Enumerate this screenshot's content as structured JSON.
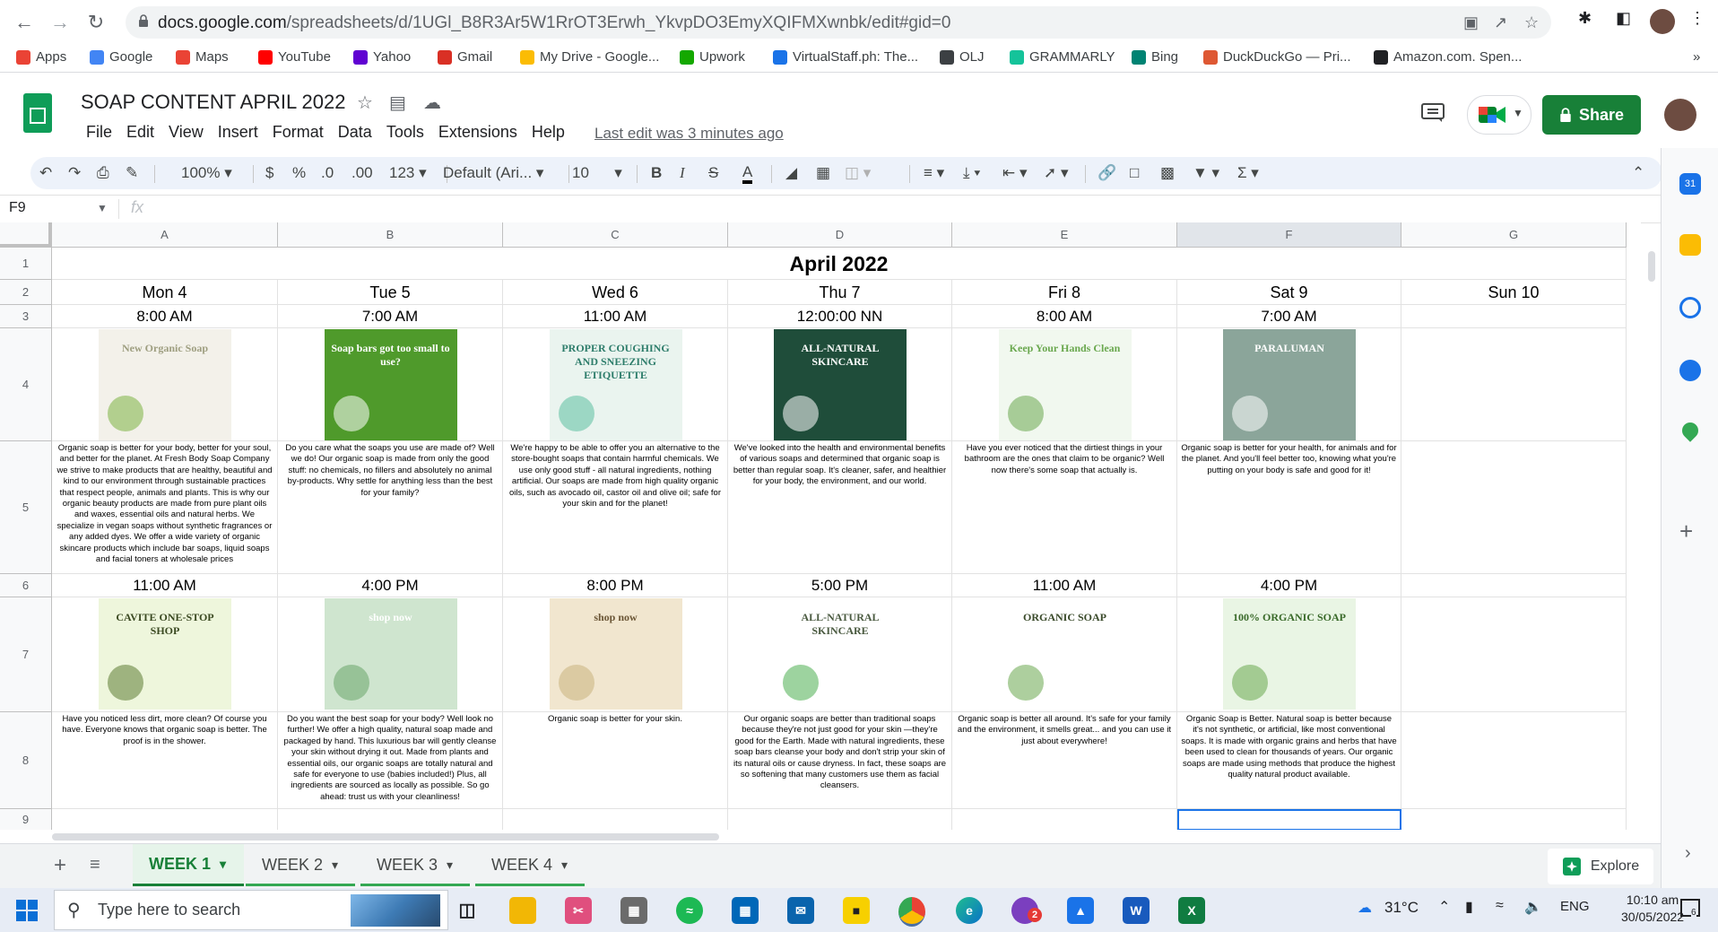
{
  "browser": {
    "url_domain": "docs.google.com",
    "url_path": "/spreadsheets/d/1UGl_B8R3Ar5W1RrOT3Erwh_YkvpDO3EmyXQIFMXwnbk/edit#gid=0",
    "bookmarks": [
      {
        "label": "Apps",
        "icon": "apps-grid-icon",
        "color": "#ea4335"
      },
      {
        "label": "Google",
        "icon": "google-icon",
        "color": "#4285f4"
      },
      {
        "label": "Maps",
        "icon": "maps-pin-icon",
        "color": "#ea4335"
      },
      {
        "label": "YouTube",
        "icon": "youtube-icon",
        "color": "#ff0000"
      },
      {
        "label": "Yahoo",
        "icon": "yahoo-icon",
        "color": "#6001d2"
      },
      {
        "label": "Gmail",
        "icon": "gmail-icon",
        "color": "#d93025"
      },
      {
        "label": "My Drive - Google...",
        "icon": "drive-icon",
        "color": "#fbbc04"
      },
      {
        "label": "Upwork",
        "icon": "upwork-icon",
        "color": "#14a800"
      },
      {
        "label": "VirtualStaff.ph: The...",
        "icon": "virtualstaff-icon",
        "color": "#1a73e8"
      },
      {
        "label": "OLJ",
        "icon": "olj-icon",
        "color": "#3c4043"
      },
      {
        "label": "GRAMMARLY",
        "icon": "grammarly-icon",
        "color": "#15c39a"
      },
      {
        "label": "Bing",
        "icon": "bing-icon",
        "color": "#008373"
      },
      {
        "label": "DuckDuckGo — Pri...",
        "icon": "duckduckgo-icon",
        "color": "#de5833"
      },
      {
        "label": "Amazon.com. Spen...",
        "icon": "amazon-icon",
        "color": "#202124"
      }
    ]
  },
  "doc": {
    "title": "SOAP CONTENT APRIL 2022",
    "last_edit": "Last edit was 3 minutes ago",
    "share_label": "Share",
    "menu": [
      "File",
      "Edit",
      "View",
      "Insert",
      "Format",
      "Data",
      "Tools",
      "Extensions",
      "Help"
    ]
  },
  "toolbar": {
    "zoom": "100%",
    "currency": "$",
    "percent": "%",
    "dec_decrease": ".0",
    "dec_increase": ".00",
    "number_format": "123",
    "font": "Default (Ari...",
    "font_size": "10"
  },
  "formula_bar": {
    "name_box": "F9",
    "fx": "fx"
  },
  "grid": {
    "columns": [
      "A",
      "B",
      "C",
      "D",
      "E",
      "F",
      "G"
    ],
    "selected_column": "F",
    "rows": [
      "1",
      "2",
      "3",
      "4",
      "5",
      "6",
      "7",
      "8",
      "9"
    ],
    "month_title": "April 2022",
    "days": [
      "Mon 4",
      "Tue 5",
      "Wed 6",
      "Thu 7",
      "Fri 8",
      "Sat 9",
      "Sun 10"
    ],
    "times_row3": [
      "8:00 AM",
      "7:00 AM",
      "11:00 AM",
      "12:00:00 NN",
      "8:00 AM",
      "7:00 AM",
      ""
    ],
    "times_row6": [
      "11:00 AM",
      "4:00 PM",
      "8:00 PM",
      "5:00 PM",
      "11:00 AM",
      "4:00 PM",
      ""
    ],
    "captions_row5": [
      "Organic soap is better for your body, better for your soul, and better for the planet. At Fresh Body Soap Company we strive to make products that are healthy, beautiful and kind to our environment through sustainable practices that respect people, animals and plants. This is why our organic beauty products are made from pure plant oils and waxes, essential oils and natural herbs. We specialize in vegan soaps without synthetic fragrances or any added dyes. We offer a wide variety of organic skincare products which include bar soaps, liquid soaps and facial toners at wholesale prices",
      "Do you care what the soaps you use are made of? Well we do! Our organic soap is made from only the good stuff: no chemicals, no fillers and absolutely no animal by-products. Why settle for anything less than the best for your family?",
      "We're happy to be able to offer you an alternative to the store-bought soaps that contain harmful chemicals. We use only good stuff - all natural ingredients, nothing artificial. Our soaps are made from high quality organic oils, such as avocado oil, castor oil and olive oil; safe for your skin and for the planet!",
      "We've looked into the health and environmental benefits of various soaps and determined that organic soap is better than regular soap. It's cleaner, safer, and healthier for your body, the environment, and our world.",
      "Have you ever noticed that the dirtiest things in your bathroom are the ones that claim to be organic? Well now there's some soap that actually is.",
      "Organic soap is better for your health, for animals and for the planet. And you'll feel better too, knowing what you're putting on your body is safe and good for it!",
      ""
    ],
    "captions_row8": [
      "Have you noticed less dirt, more clean? Of course you have. Everyone knows that organic soap is better. The proof is in the shower.",
      "Do you want the best soap for your body? Well look no further! We offer a high quality, natural soap made and packaged by hand. This luxurious bar will gently cleanse your skin without drying it out. Made from plants and essential oils, our organic soaps are totally natural and safe for everyone to use (babies included!) Plus, all ingredients are sourced as locally as possible. So go ahead: trust us with your cleanliness!",
      "Organic soap is better for your skin.",
      "Our organic soaps are better than traditional soaps because they're not just good for your skin —they're good for the Earth. Made with natural ingredients, these soap bars cleanse your body and don't strip your skin of its natural oils or cause dryness. In fact, these soaps are so softening that many customers use them as facial cleansers.",
      "Organic soap is better all around. It's safe for your family and the environment, it smells great... and you can use it just about everywhere!",
      "Organic Soap is Better. Natural soap is better because it's not synthetic, or artificial, like most conventional soaps. It is made with organic grains and herbs that have been used to clean for thousands of years. Our organic soaps are made using methods that produce the highest quality natural product available.",
      ""
    ],
    "images_row4": [
      {
        "name": "new-organic-soap-post",
        "bg": "#f3f1ea",
        "accent": "#7bb342",
        "text": "New Organic Soap",
        "text_color": "#9e9e80"
      },
      {
        "name": "soap-bars-too-small-post",
        "bg": "#4f9a2b",
        "accent": "#ffffff",
        "text": "Soap bars got too small to use?",
        "text_color": "#ffffff"
      },
      {
        "name": "coughing-sneezing-etiquette-post",
        "bg": "#eaf4ef",
        "accent": "#5bbfa0",
        "text": "PROPER COUGHING AND SNEEZING ETIQUETTE",
        "text_color": "#2e7d6b"
      },
      {
        "name": "all-natural-skincare-dark-post",
        "bg": "#1f4d3a",
        "accent": "#ffffff",
        "text": "ALL-NATURAL SKINCARE",
        "text_color": "#ffffff"
      },
      {
        "name": "keep-your-hands-clean-post",
        "bg": "#f1f8ef",
        "accent": "#6aa84f",
        "text": "Keep Your Hands Clean",
        "text_color": "#6aa84f"
      },
      {
        "name": "paraluman-shop-post",
        "bg": "#8ba59a",
        "accent": "#ffffff",
        "text": "PARALUMAN",
        "text_color": "#ffffff"
      }
    ],
    "images_row7": [
      {
        "name": "cavite-one-stop-shop-post",
        "bg": "#eef6dc",
        "accent": "#5d7b33",
        "text": "CAVITE ONE-STOP SHOP",
        "text_color": "#3b4a22"
      },
      {
        "name": "shop-now-menu-post",
        "bg": "#cfe5cf",
        "accent": "#6aa66a",
        "text": "shop now",
        "text_color": "#ffffff"
      },
      {
        "name": "shop-now-beige-post",
        "bg": "#f1e6cf",
        "accent": "#c8b27e",
        "text": "shop now",
        "text_color": "#6b5636"
      },
      {
        "name": "all-natural-skincare-floral-post",
        "bg": "#ffffff",
        "accent": "#4caf50",
        "text": "ALL-NATURAL SKINCARE",
        "text_color": "#4a5a40"
      },
      {
        "name": "organic-soap-green-post",
        "bg": "#ffffff",
        "accent": "#6aa84f",
        "text": "ORGANIC SOAP",
        "text_color": "#3a4a2a"
      },
      {
        "name": "100-organic-soap-checklist-post",
        "bg": "#e9f5e4",
        "accent": "#6aa84f",
        "text": "100% ORGANIC SOAP",
        "text_color": "#3a6a2a"
      }
    ]
  },
  "sheet_tabs": [
    "WEEK 1",
    "WEEK 2",
    "WEEK 3",
    "WEEK 4"
  ],
  "explore_label": "Explore",
  "taskbar": {
    "search_placeholder": "Type here to search",
    "weather": "31°C",
    "language": "ENG",
    "time": "10:10 am",
    "date": "30/05/2022",
    "notification_count": "6",
    "app_badge": "2"
  }
}
